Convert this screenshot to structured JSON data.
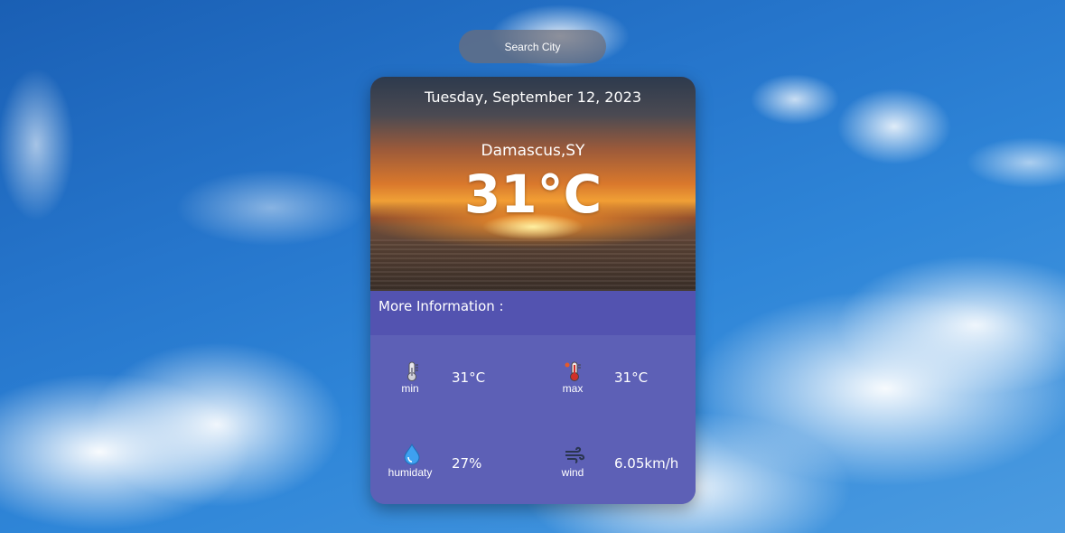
{
  "search": {
    "placeholder": "Search City"
  },
  "card": {
    "date": "Tuesday, September 12, 2023",
    "city": "Damascus,SY",
    "temperature": "31°C",
    "more_info_label": "More Information :",
    "stats": {
      "min": {
        "label": "min",
        "value": "31°C",
        "icon": "thermometer-icon"
      },
      "max": {
        "label": "max",
        "value": "31°C",
        "icon": "hot-thermometer-icon"
      },
      "humidity": {
        "label": "humidaty",
        "value": "27%",
        "icon": "water-drop-icon"
      },
      "wind": {
        "label": "wind",
        "value": "6.05km/h",
        "icon": "wind-icon"
      }
    }
  },
  "colors": {
    "card_bg": "#5d60b6",
    "more_bar": "#5353b0",
    "sky": "#2676cc"
  }
}
